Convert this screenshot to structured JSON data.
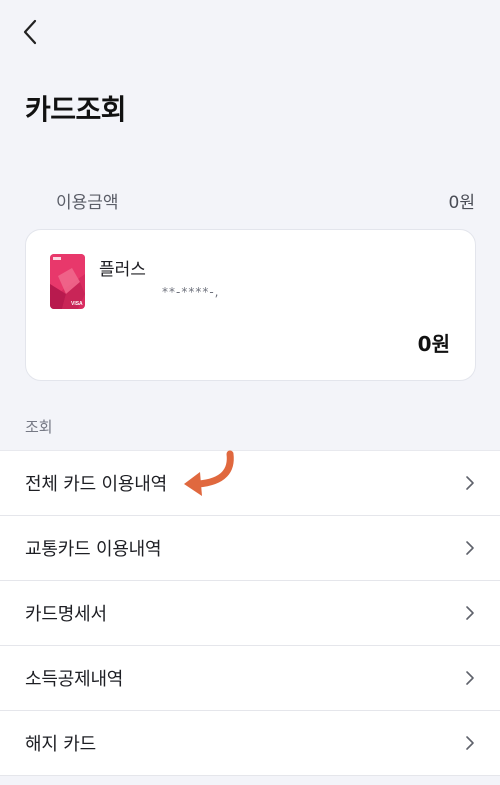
{
  "header": {
    "back_icon": "chevron-left-icon",
    "title": "카드조회"
  },
  "usage": {
    "label": "이용금액",
    "amount": "0원"
  },
  "card": {
    "name": "플러스",
    "number": "**-****-,",
    "total": "0원",
    "image_brand": "VISA",
    "image_colors": [
      "#e8386b",
      "#c21f56",
      "#f06a8d"
    ]
  },
  "section": {
    "label": "조회"
  },
  "menu": {
    "items": [
      {
        "label": "전체 카드 이용내역"
      },
      {
        "label": "교통카드 이용내역"
      },
      {
        "label": "카드명세서"
      },
      {
        "label": "소득공제내역"
      },
      {
        "label": "해지 카드"
      }
    ],
    "chevron_icon": "chevron-right-icon"
  },
  "annotation": {
    "icon": "curved-arrow-left-icon",
    "color": "#e0683e"
  }
}
